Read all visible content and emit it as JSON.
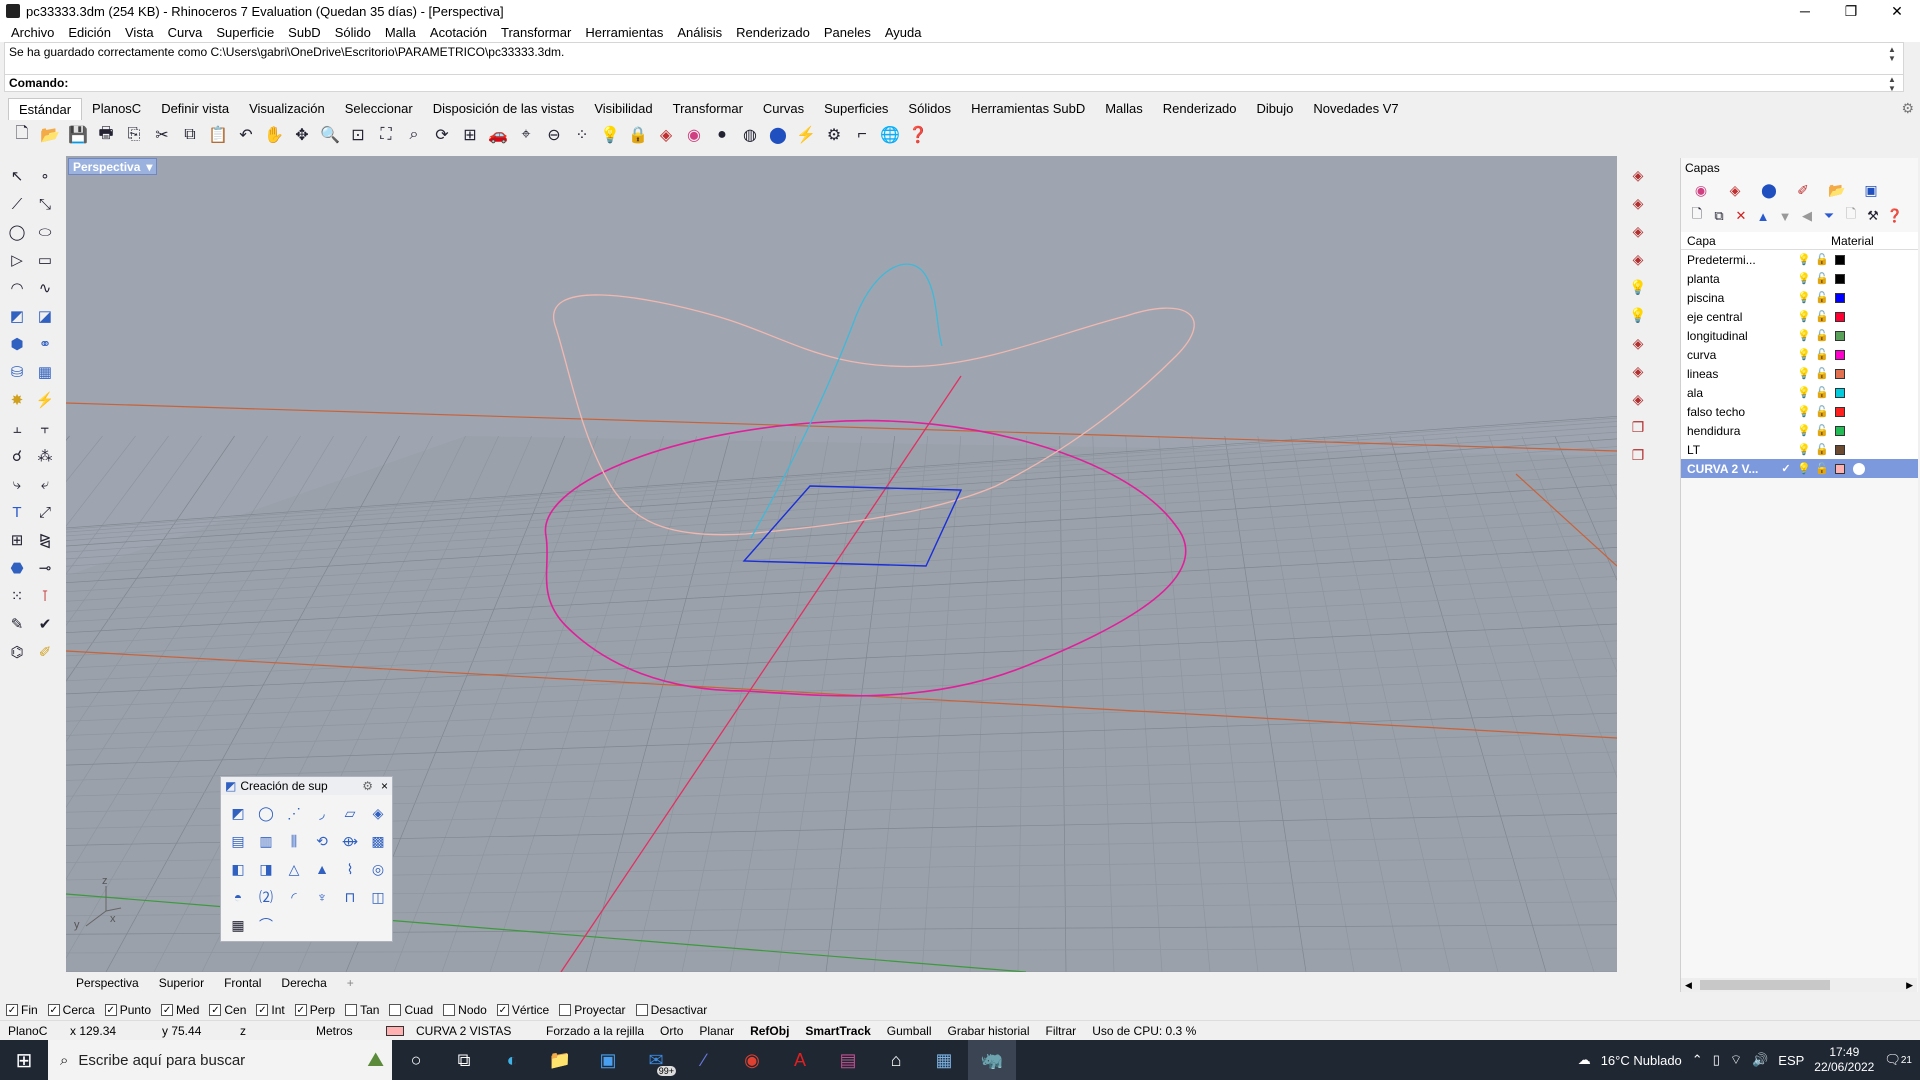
{
  "window": {
    "title": "pc33333.3dm (254 KB) - Rhinoceros 7 Evaluation (Quedan 35 días) - [Perspectiva]",
    "controls": [
      "─",
      "❐",
      "✕"
    ]
  },
  "menu": [
    "Archivo",
    "Edición",
    "Vista",
    "Curva",
    "Superficie",
    "SubD",
    "Sólido",
    "Malla",
    "Acotación",
    "Transformar",
    "Herramientas",
    "Análisis",
    "Renderizado",
    "Paneles",
    "Ayuda"
  ],
  "command": {
    "history": "Se ha guardado correctamente como C:\\Users\\gabri\\OneDrive\\Escritorio\\PARAMETRICO\\pc33333.3dm.",
    "prompt": "Comando:"
  },
  "tabs": [
    "Estándar",
    "PlanosC",
    "Definir vista",
    "Visualización",
    "Seleccionar",
    "Disposición de las vistas",
    "Visibilidad",
    "Transformar",
    "Curvas",
    "Superficies",
    "Sólidos",
    "Herramientas SubD",
    "Mallas",
    "Renderizado",
    "Dibujo",
    "Novedades V7"
  ],
  "viewport": {
    "label": "Perspectiva",
    "tabs": [
      "Perspectiva",
      "Superior",
      "Frontal",
      "Derecha"
    ],
    "add_tab": "+",
    "axes": {
      "z": "z",
      "y": "y",
      "x": "x"
    }
  },
  "float_panel": {
    "title": "Creación de sup",
    "settings_icon": "⚙",
    "close": "×"
  },
  "layers_panel": {
    "title": "Capas",
    "col_layer": "Capa",
    "col_material": "Material",
    "layers": [
      {
        "name": "Predetermi...",
        "color": "#000000",
        "selected": false
      },
      {
        "name": "planta",
        "color": "#000000",
        "selected": false
      },
      {
        "name": "piscina",
        "color": "#0000ff",
        "selected": false
      },
      {
        "name": "eje central",
        "color": "#ff0033",
        "selected": false
      },
      {
        "name": "longitudinal",
        "color": "#5aa05a",
        "selected": false
      },
      {
        "name": "curva",
        "color": "#ff00cc",
        "selected": false
      },
      {
        "name": "lineas",
        "color": "#e07050",
        "selected": false
      },
      {
        "name": "ala",
        "color": "#00ccdd",
        "selected": false
      },
      {
        "name": "falso techo",
        "color": "#ff2020",
        "selected": false
      },
      {
        "name": "hendidura",
        "color": "#22bb55",
        "selected": false
      },
      {
        "name": "LT",
        "color": "#6a4a30",
        "selected": false
      },
      {
        "name": "CURVA 2 V...",
        "color": "#ffb0b0",
        "selected": true
      }
    ]
  },
  "osnaps": [
    {
      "label": "Fin",
      "checked": true
    },
    {
      "label": "Cerca",
      "checked": true
    },
    {
      "label": "Punto",
      "checked": true
    },
    {
      "label": "Med",
      "checked": true
    },
    {
      "label": "Cen",
      "checked": true
    },
    {
      "label": "Int",
      "checked": true
    },
    {
      "label": "Perp",
      "checked": true
    },
    {
      "label": "Tan",
      "checked": false
    },
    {
      "label": "Cuad",
      "checked": false
    },
    {
      "label": "Nodo",
      "checked": false
    },
    {
      "label": "Vértice",
      "checked": true
    },
    {
      "label": "Proyectar",
      "checked": false
    },
    {
      "label": "Desactivar",
      "checked": false
    }
  ],
  "status": {
    "cplane": "PlanoC",
    "x": "x 129.34",
    "y": "y 75.44",
    "z": "z",
    "units": "Metros",
    "layer": "CURVA 2 VISTAS",
    "grid_snap": "Forzado a la rejilla",
    "ortho": "Orto",
    "planar": "Planar",
    "osnap": "RefObj",
    "smarttrack": "SmartTrack",
    "gumball": "Gumball",
    "history": "Grabar historial",
    "filter": "Filtrar",
    "cpu": "Uso de CPU: 0.3 %"
  },
  "taskbar": {
    "search_placeholder": "Escribe aquí para buscar",
    "mail_badge": "99+",
    "weather": "16°C  Nublado",
    "lang": "ESP",
    "time": "17:49",
    "date": "22/06/2022",
    "notif": "21"
  },
  "colors": {
    "viewport_bg": "#9ea5b0",
    "grid": "#8e959f",
    "grid_major": "#7f868f",
    "x_axis": "#c8623a",
    "y_axis": "#3c9a3c",
    "magenta_curve": "#e0209a",
    "pink_curve": "#f0b8b0",
    "cyan_curve": "#40b8d8",
    "blue_rect": "#1a2fd8",
    "red_line": "#e23060"
  }
}
